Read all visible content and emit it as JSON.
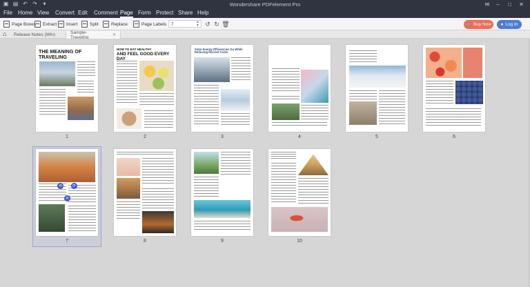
{
  "window": {
    "title": "Wondershare PDFelement Pro"
  },
  "menu": [
    "File",
    "Home",
    "View",
    "Convert",
    "Edit",
    "Comment",
    "Page",
    "Form",
    "Protect",
    "Share",
    "Help"
  ],
  "active_menu": "Page",
  "toolbar": {
    "page_boxes": "Page Boxes",
    "extract": "Extract",
    "insert": "Insert",
    "split": "Split",
    "replace": "Replace",
    "page_labels": "Page Labels",
    "page_number_value": "7",
    "buy_now": "Buy Now",
    "log_in": "Log In"
  },
  "tabs": [
    {
      "label": "Release Notes (Win)"
    },
    {
      "label": "Sample-Traveling"
    }
  ],
  "pages": [
    {
      "num": "1",
      "heading": "THE MEANING OF TRAVELING"
    },
    {
      "num": "2",
      "heading_small": "HOW TO EAT HEALTHY",
      "heading": "AND FEEL GOOD EVERY DAY"
    },
    {
      "num": "3",
      "heading": "Solar Energy Efficiencies Go While Reducing Harvest Costs"
    },
    {
      "num": "4",
      "heading": ""
    },
    {
      "num": "5",
      "heading": ""
    },
    {
      "num": "6",
      "heading": ""
    },
    {
      "num": "7",
      "heading": ""
    },
    {
      "num": "8",
      "heading": ""
    },
    {
      "num": "9",
      "heading": ""
    },
    {
      "num": "10",
      "heading": ""
    }
  ],
  "selected_page": "7",
  "colors": {
    "titlebar": "#2f3440",
    "buy_now": "#ef6d57",
    "log_in": "#4a7bd9",
    "selection": "#9aa3da"
  }
}
